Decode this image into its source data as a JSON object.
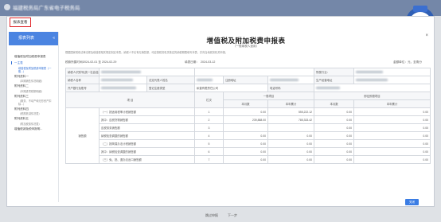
{
  "app": {
    "title": "福建税务局广东省电子税务局",
    "back": "返"
  },
  "modal": {
    "tab_label": "报表查看",
    "close": "×",
    "confirm": "关闭"
  },
  "sidebar": {
    "header": "报表列表",
    "collapse": "«",
    "items": [
      {
        "label": "增值税及附加税费申报表",
        "sub": ""
      },
      {
        "label": "一主表",
        "sub": "增值税及附加税费申报表（一般...）",
        "active": true
      },
      {
        "label": "附列资料一",
        "sub": "（本期销售情况明细）"
      },
      {
        "label": "附列资料二",
        "sub": "（本期进项税额明细）"
      },
      {
        "label": "附列资料三",
        "sub": "（服务、不动产和无形资产扣除...）"
      },
      {
        "label": "附列资料四",
        "sub": "（税额抵减情况表）"
      },
      {
        "label": "附列资料五",
        "sub": "（附加税费情况表）"
      },
      {
        "label": "增值税减免税申报明...",
        "sub": ""
      }
    ]
  },
  "form": {
    "title": "增值税及附加税费申报表",
    "subtitle": "（一般纳税人适用）",
    "notice": "根据国家税收法律法规及增值税相关规定制定本表。纳税人不论有无销售额，均应按税务机关核定的纳税期限填写本表，并向当地税务机关申报。",
    "period_label": "税款所属时间：",
    "period_value": "2024-02-01 至 2024-02-29",
    "fill_date_label": "填表日期：",
    "fill_date_value": "2024-03-12",
    "unit": "金额单位：元，至角分",
    "rows_info": [
      {
        "l1": "纳税人识别号(统一社会信用代码)",
        "v1": "",
        "l2": "",
        "v2": "",
        "l3": "所属行业：",
        "v3": ""
      },
      {
        "l1": "纳税人名称",
        "v1": "",
        "l2": "法定代表人姓名",
        "v2": "",
        "l3": "注册地址",
        "v3": "",
        "l4": "生产经营地址",
        "v4": ""
      },
      {
        "l1": "开户银行及账号",
        "v1": "",
        "l2": "登记注册类型",
        "v2": "私营有限责任公司",
        "l3": "电话号码",
        "v3": ""
      }
    ],
    "col_headers": {
      "project": "项  目",
      "lineno": "栏次",
      "general": "一般项目",
      "refund": "即征即退项目",
      "month": "本月数",
      "ytd": "本年累计"
    },
    "group_label": "销售额",
    "lines": [
      {
        "name": "（一）按适用税率计税销售额",
        "no": "1",
        "m1": "0.00",
        "y1": "555,222.12",
        "m2": "0.00",
        "y2": "0.00"
      },
      {
        "name": "其中：应税货物销售额",
        "no": "2",
        "m1": "239,888.00",
        "y1": "785,333.42",
        "m2": "0.00",
        "y2": "0.00"
      },
      {
        "name": "应税劳务销售额",
        "no": "3",
        "m1": "",
        "y1": "",
        "m2": "0.00",
        "y2": "0.00"
      },
      {
        "name": "纳税检查调整的销售额",
        "no": "4",
        "m1": "0.00",
        "y1": "0.00",
        "m2": "0.00",
        "y2": "0.00"
      },
      {
        "name": "（二）按简易办法计税销售额",
        "no": "5",
        "m1": "0.00",
        "y1": "0.00",
        "m2": "0.00",
        "y2": "0.00"
      },
      {
        "name": "其中：纳税检查调整的销售额",
        "no": "6",
        "m1": "0.00",
        "y1": "0.00",
        "m2": "0.00",
        "y2": "0.00"
      },
      {
        "name": "（三）免、抵、退办法出口销售额",
        "no": "7",
        "m1": "0.00",
        "y1": "0.00",
        "m2": "0.00",
        "y2": "0.00"
      }
    ]
  },
  "footer": {
    "prev": "跳过申报",
    "next": "下一步"
  },
  "colors": {
    "topbar": "#7487a8",
    "accent": "#4b84e1",
    "tab_border": "#e0262a"
  }
}
